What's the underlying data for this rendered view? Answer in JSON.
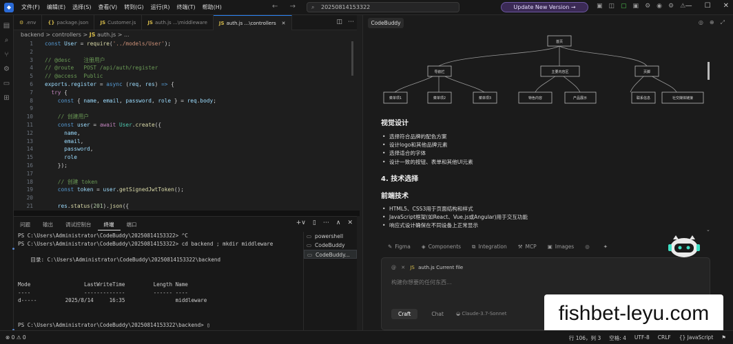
{
  "menu": [
    "文件(F)",
    "编辑(E)",
    "选择(S)",
    "查看(V)",
    "转到(G)",
    "运行(R)",
    "终端(T)",
    "帮助(H)"
  ],
  "nav": {
    "back": "←",
    "forward": "→"
  },
  "search": {
    "value": "20250814153322"
  },
  "update_button": "Update New Version  →",
  "title_icons": [
    "▣",
    "◫",
    "▢",
    "▣",
    "⚙",
    "◉",
    "⚙",
    "⚠"
  ],
  "window_controls": {
    "minimize": "—",
    "maximize": "☐",
    "close": "✕"
  },
  "activity_icons": [
    "▤",
    "⌕",
    "⑂",
    "⚙",
    "▭",
    "⊞"
  ],
  "tabs": [
    {
      "icon": "⚙",
      "name": ".env",
      "path": ""
    },
    {
      "icon": "{}",
      "name": "package.json",
      "path": ""
    },
    {
      "icon": "JS",
      "name": "Customer.js",
      "path": ""
    },
    {
      "icon": "JS",
      "name": "auth.js",
      "path": "...\\middleware"
    },
    {
      "icon": "JS",
      "name": "auth.js",
      "path": "...\\controllers",
      "active": true
    }
  ],
  "tab_close": "✕",
  "tab_icons": [
    "◫",
    "⋯"
  ],
  "breadcrumb": {
    "part1": "backend",
    "sep": ">",
    "part2": "controllers",
    "js": "JS",
    "file": "auth.js",
    "more": "> ..."
  },
  "code_lines": [
    {
      "n": "1",
      "t": [
        [
          "k",
          "const "
        ],
        [
          "v",
          "User"
        ],
        [
          "p",
          " = "
        ],
        [
          "f",
          "require"
        ],
        [
          "p",
          "("
        ],
        [
          "s",
          "'../models/User'"
        ],
        [
          "p",
          ");"
        ]
      ]
    },
    {
      "n": "2",
      "t": []
    },
    {
      "n": "3",
      "t": [
        [
          "c",
          "// @desc    注册用户"
        ]
      ]
    },
    {
      "n": "4",
      "t": [
        [
          "c",
          "// @route   POST /api/auth/register"
        ]
      ]
    },
    {
      "n": "5",
      "t": [
        [
          "c",
          "// @access  Public"
        ]
      ]
    },
    {
      "n": "6",
      "t": [
        [
          "v",
          "exports"
        ],
        [
          "p",
          "."
        ],
        [
          "v",
          "register"
        ],
        [
          "p",
          " = "
        ],
        [
          "k",
          "async "
        ],
        [
          "p",
          "("
        ],
        [
          "v",
          "req"
        ],
        [
          "p",
          ", "
        ],
        [
          "v",
          "res"
        ],
        [
          "p",
          ") "
        ],
        [
          "k",
          "=>"
        ],
        [
          "p",
          " {"
        ]
      ]
    },
    {
      "n": "7",
      "t": [
        [
          "p",
          "  "
        ],
        [
          "o",
          "try"
        ],
        [
          "p",
          " {"
        ]
      ]
    },
    {
      "n": "8",
      "t": [
        [
          "p",
          "    "
        ],
        [
          "k",
          "const "
        ],
        [
          "p",
          "{ "
        ],
        [
          "v",
          "name"
        ],
        [
          "p",
          ", "
        ],
        [
          "v",
          "email"
        ],
        [
          "p",
          ", "
        ],
        [
          "v",
          "password"
        ],
        [
          "p",
          ", "
        ],
        [
          "v",
          "role"
        ],
        [
          "p",
          " } = "
        ],
        [
          "v",
          "req"
        ],
        [
          "p",
          "."
        ],
        [
          "v",
          "body"
        ],
        [
          "p",
          ";"
        ]
      ]
    },
    {
      "n": "9",
      "t": []
    },
    {
      "n": "10",
      "t": [
        [
          "p",
          "    "
        ],
        [
          "c",
          "// 创建用户"
        ]
      ]
    },
    {
      "n": "11",
      "t": [
        [
          "p",
          "    "
        ],
        [
          "k",
          "const "
        ],
        [
          "v",
          "user"
        ],
        [
          "p",
          " = "
        ],
        [
          "o",
          "await "
        ],
        [
          "cl",
          "User"
        ],
        [
          "p",
          "."
        ],
        [
          "f",
          "create"
        ],
        [
          "p",
          "({"
        ]
      ]
    },
    {
      "n": "12",
      "t": [
        [
          "p",
          "      "
        ],
        [
          "v",
          "name"
        ],
        [
          "p",
          ","
        ]
      ]
    },
    {
      "n": "13",
      "t": [
        [
          "p",
          "      "
        ],
        [
          "v",
          "email"
        ],
        [
          "p",
          ","
        ]
      ]
    },
    {
      "n": "14",
      "t": [
        [
          "p",
          "      "
        ],
        [
          "v",
          "password"
        ],
        [
          "p",
          ","
        ]
      ]
    },
    {
      "n": "15",
      "t": [
        [
          "p",
          "      "
        ],
        [
          "v",
          "role"
        ]
      ]
    },
    {
      "n": "16",
      "t": [
        [
          "p",
          "    });"
        ]
      ]
    },
    {
      "n": "17",
      "t": []
    },
    {
      "n": "18",
      "t": [
        [
          "p",
          "    "
        ],
        [
          "c",
          "// 创建 token"
        ]
      ]
    },
    {
      "n": "19",
      "t": [
        [
          "p",
          "    "
        ],
        [
          "k",
          "const "
        ],
        [
          "v",
          "token"
        ],
        [
          "p",
          " = "
        ],
        [
          "v",
          "user"
        ],
        [
          "p",
          "."
        ],
        [
          "f",
          "getSignedJwtToken"
        ],
        [
          "p",
          "();"
        ]
      ]
    },
    {
      "n": "20",
      "t": []
    },
    {
      "n": "21",
      "t": [
        [
          "p",
          "    "
        ],
        [
          "v",
          "res"
        ],
        [
          "p",
          "."
        ],
        [
          "f",
          "status"
        ],
        [
          "p",
          "("
        ],
        [
          "n",
          "201"
        ],
        [
          "p",
          ")."
        ],
        [
          "f",
          "json"
        ],
        [
          "p",
          "({"
        ]
      ]
    }
  ],
  "panel_tabs": [
    "问题",
    "输出",
    "调试控制台",
    "终端",
    "端口"
  ],
  "panel_icons": [
    "+∨",
    "▯",
    "⋯",
    "∧",
    "✕"
  ],
  "terminal_lines": [
    {
      "text": "PS C:\\Users\\Administrator\\CodeBuddy\\20250814153322> ^C",
      "dot": ""
    },
    {
      "text": "PS C:\\Users\\Administrator\\CodeBuddy\\20250814153322> cd backend ; mkdir middleware",
      "dot": "●"
    },
    {
      "text": "",
      "dot": ""
    },
    {
      "text": "    目录: C:\\Users\\Administrator\\CodeBuddy\\20250814153322\\backend",
      "dot": ""
    },
    {
      "text": "",
      "dot": ""
    },
    {
      "text": "",
      "dot": ""
    },
    {
      "text": "Mode                 LastWriteTime         Length Name",
      "dot": ""
    },
    {
      "text": "----                 -------------         ------ ----",
      "dot": ""
    },
    {
      "text": "d-----         2025/8/14     16:35                middleware",
      "dot": ""
    },
    {
      "text": "",
      "dot": ""
    },
    {
      "text": "",
      "dot": ""
    },
    {
      "text": "PS C:\\Users\\Administrator\\CodeBuddy\\20250814153322\\backend> ▯",
      "dot": "●"
    }
  ],
  "terminal_list": [
    "powershell",
    "CodeBuddy",
    "CodeBuddy..."
  ],
  "codebuddy": {
    "tab": "CodeBuddy",
    "icons": [
      "◎",
      "⊕",
      "⤢"
    ],
    "diagram": {
      "root": "首页",
      "level1": [
        "导航栏",
        "主要内容区",
        "页脚"
      ],
      "level2": [
        "菜单项1",
        "菜单项2",
        "菜单项3",
        "特色内容",
        "产品展示",
        "联系信息",
        "社交媒体链接"
      ]
    },
    "visual_design_heading": "视觉设计",
    "visual_design_items": [
      "选择符合品牌的配色方案",
      "设计logo和其他品牌元素",
      "选择适合的字体",
      "设计一致的按钮、表单和其他UI元素"
    ],
    "tech_heading": "4. 技术选择",
    "frontend_heading": "前端技术",
    "frontend_items": [
      "HTML5、CSS3用于页面结构和样式",
      "JavaScript框架(如React、Vue.js或Angular)用于交互功能",
      "响应式设计确保在不同设备上正常显示"
    ],
    "collapse": "⌄",
    "tools": [
      {
        "icon": "✎",
        "label": "Figma"
      },
      {
        "icon": "◈",
        "label": "Components"
      },
      {
        "icon": "⧉",
        "label": "Integration"
      },
      {
        "icon": "⚒",
        "label": "MCP"
      },
      {
        "icon": "▣",
        "label": "Images"
      },
      {
        "icon": "◎",
        "label": ""
      },
      {
        "icon": "✦",
        "label": ""
      }
    ],
    "chip": {
      "at": "@",
      "close": "✕",
      "js": "JS",
      "file": "auth.js",
      "label": "Current file"
    },
    "placeholder": "构建你想要的任何东西...",
    "modes": [
      "Craft",
      "Chat"
    ],
    "model": "◒  Claude-3.7-Sonnet"
  },
  "watermark": "fishbet-leyu.com",
  "status": {
    "left": "⊗ 0  ⚠ 0",
    "right": [
      "行 106，列 3",
      "空格: 4",
      "UTF-8",
      "CRLF",
      "{} JavaScript",
      "⚑"
    ]
  }
}
